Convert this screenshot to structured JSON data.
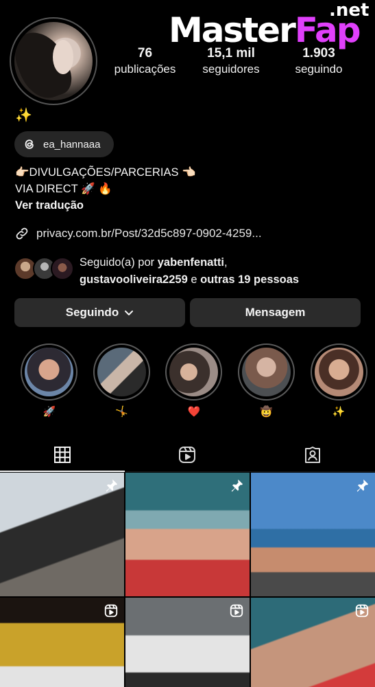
{
  "watermark": {
    "part1": "Master",
    "part2": "Fap",
    "suffix": ".net"
  },
  "profile": {
    "stats": [
      {
        "value": "76",
        "label": "publicações"
      },
      {
        "value": "15,1 mil",
        "label": "seguidores"
      },
      {
        "value": "1.903",
        "label": "seguindo"
      }
    ],
    "sparkle": "✨",
    "threads_handle": "ea_hannaaa",
    "bio_line1": "👉🏻DIVULGAÇÕES/PARCERIAS 👈🏻",
    "bio_line2": "VIA DIRECT 🚀 🔥",
    "translate": "Ver tradução",
    "link": "privacy.com.br/Post/32d5c897-0902-4259...",
    "followed_prefix": "Seguido(a) por ",
    "followed_user1": "yabenfenatti",
    "followed_sep": ",",
    "followed_user2": "gustavooliveira2259",
    "followed_mid": " e ",
    "followed_others": "outras 19 pessoas"
  },
  "actions": {
    "following": "Seguindo",
    "message": "Mensagem"
  },
  "highlights": [
    {
      "label": "🚀"
    },
    {
      "label": "🤸"
    },
    {
      "label": "❤️"
    },
    {
      "label": "🤠"
    },
    {
      "label": "✨"
    }
  ],
  "tabs": [
    "grid-icon",
    "reels-icon",
    "tagged-icon"
  ],
  "grid_posts": [
    {
      "badge": "pin-icon"
    },
    {
      "badge": "pin-icon"
    },
    {
      "badge": "pin-icon"
    },
    {
      "badge": "reels-icon"
    },
    {
      "badge": "reels-icon"
    },
    {
      "badge": "reels-icon"
    }
  ]
}
